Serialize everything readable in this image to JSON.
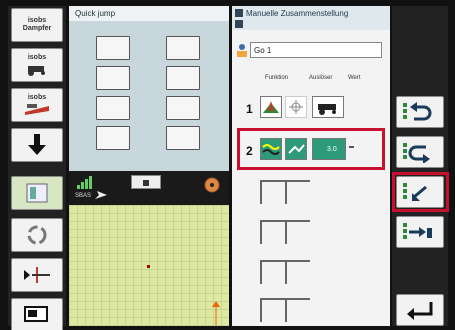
{
  "left_column": {
    "btn1_line1": "isobs",
    "btn1_line2": "Dampfer",
    "btn2_label": "isobs",
    "btn3_label": "isobs"
  },
  "quick_jump": {
    "title": "Quick jump"
  },
  "info_bar": {
    "status_text": "SBAS"
  },
  "right_panel": {
    "title": "Manuelle Zusammenstellung",
    "go_value": "Go 1",
    "col_headers": [
      "Funktion",
      "Auslöser",
      "Wert"
    ],
    "rows": [
      {
        "number": "1"
      },
      {
        "number": "2",
        "value": "3.0"
      }
    ]
  },
  "colors": {
    "highlight": "#c8102e",
    "panel_accent": "#dfe8ec",
    "map_green": "#dde8a2"
  }
}
